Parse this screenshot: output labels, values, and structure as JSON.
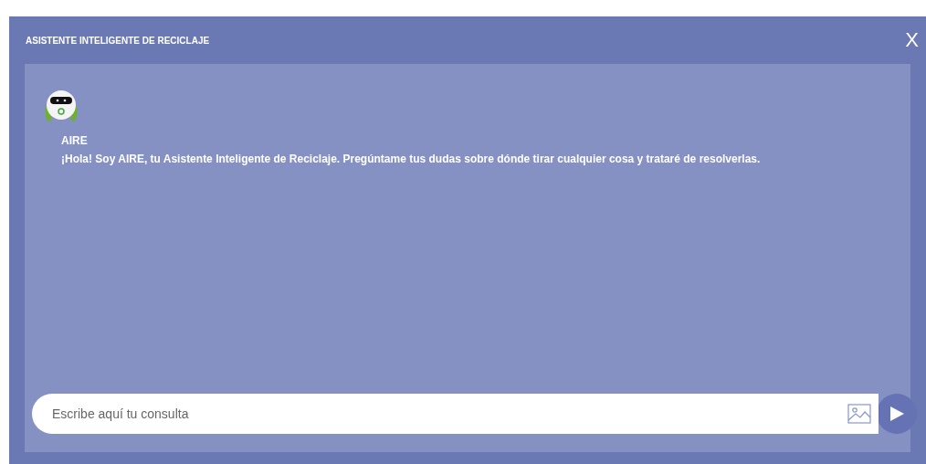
{
  "window": {
    "title": "ASISTENTE INTELIGENTE DE RECICLAJE",
    "close": "X"
  },
  "messages": [
    {
      "sender": "AIRE",
      "text": "¡Hola! Soy AIRE, tu Asistente Inteligente de Reciclaje. Pregúntame tus dudas sobre dónde tirar cualquier cosa y trataré de resolverlas."
    }
  ],
  "composer": {
    "placeholder": "Escribe aquí tu consulta"
  }
}
